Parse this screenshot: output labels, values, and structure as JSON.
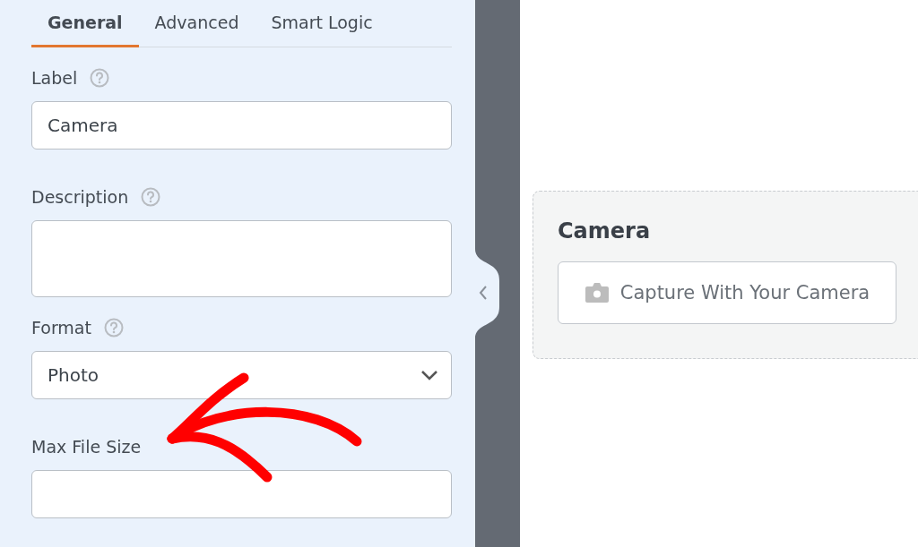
{
  "tabs": [
    {
      "label": "General",
      "selected": true
    },
    {
      "label": "Advanced",
      "selected": false
    },
    {
      "label": "Smart Logic",
      "selected": false
    }
  ],
  "fields": [
    {
      "kind": "text",
      "label": "Label",
      "help": true,
      "value": "Camera"
    },
    {
      "kind": "textarea",
      "label": "Description",
      "help": true
    },
    {
      "kind": "select",
      "label": "Format",
      "help": true,
      "value": "Photo"
    },
    {
      "kind": "text",
      "label": "Max File Size",
      "help": false
    }
  ],
  "preview": {
    "title": "Camera",
    "button": "Capture With Your Camera"
  }
}
